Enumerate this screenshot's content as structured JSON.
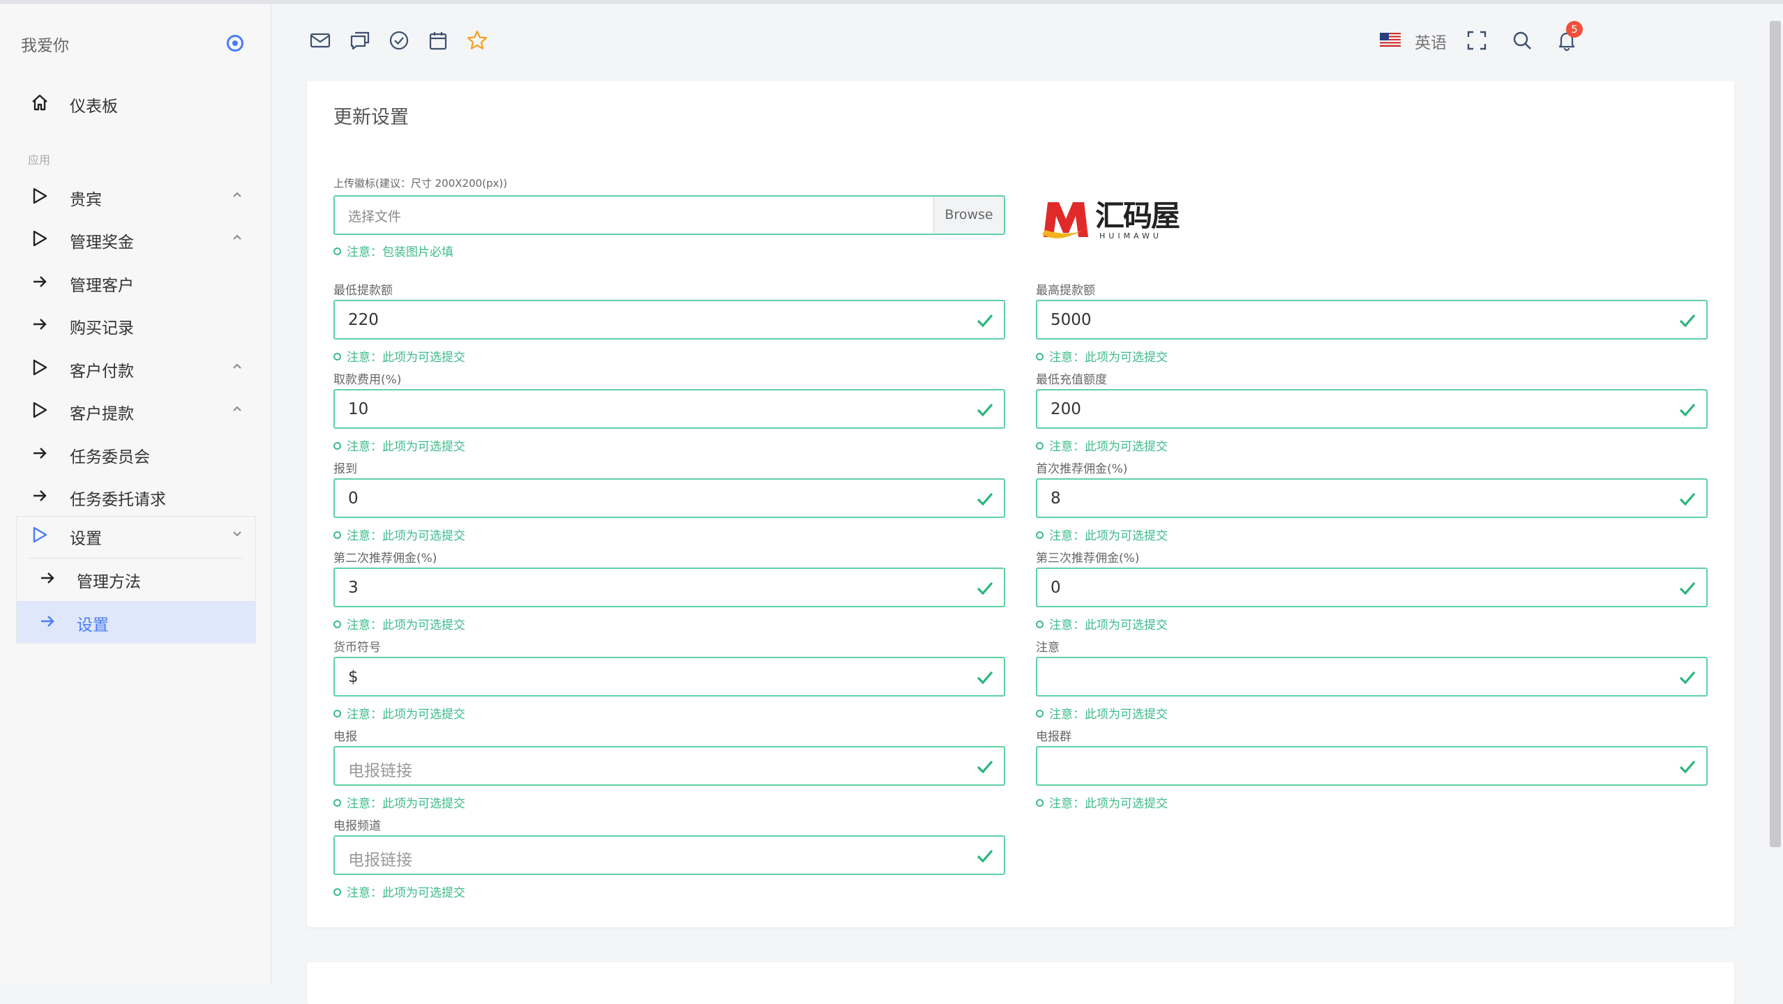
{
  "sidebar": {
    "brand": "我爱你",
    "items": [
      {
        "label": "仪表板"
      },
      {
        "label": "贵宾"
      },
      {
        "label": "管理奖金"
      },
      {
        "label": "管理客户"
      },
      {
        "label": "购买记录"
      },
      {
        "label": "客户付款"
      },
      {
        "label": "客户提款"
      },
      {
        "label": "任务委员会"
      },
      {
        "label": "任务委托请求"
      },
      {
        "label": "设置"
      },
      {
        "label": "管理方法"
      },
      {
        "label": "设置"
      }
    ],
    "section_label": "应用"
  },
  "header": {
    "language": "英语",
    "notification_count": "5"
  },
  "card": {
    "title": "更新设置",
    "upload": {
      "label": "上传徽标(建议：尺寸 200X200(px))",
      "placeholder": "选择文件",
      "browse": "Browse",
      "hint": "注意：包装图片必填"
    },
    "logo": {
      "text": "汇码屋",
      "subtext": "HUIMAWU"
    },
    "fields": [
      {
        "label": "最低提款额",
        "value": "220",
        "placeholder": "",
        "hint": "注意：此项为可选提交"
      },
      {
        "label": "最高提款额",
        "value": "5000",
        "placeholder": "",
        "hint": "注意：此项为可选提交"
      },
      {
        "label": "取款费用(%)",
        "value": "10",
        "placeholder": "",
        "hint": "注意：此项为可选提交"
      },
      {
        "label": "最低充值额度",
        "value": "200",
        "placeholder": "",
        "hint": "注意：此项为可选提交"
      },
      {
        "label": "报到",
        "value": "0",
        "placeholder": "",
        "hint": "注意：此项为可选提交"
      },
      {
        "label": "首次推荐佣金(%)",
        "value": "8",
        "placeholder": "",
        "hint": "注意：此项为可选提交"
      },
      {
        "label": "第二次推荐佣金(%)",
        "value": "3",
        "placeholder": "",
        "hint": "注意：此项为可选提交"
      },
      {
        "label": "第三次推荐佣金(%)",
        "value": "0",
        "placeholder": "",
        "hint": "注意：此项为可选提交"
      },
      {
        "label": "货币符号",
        "value": "$",
        "placeholder": "",
        "hint": "注意：此项为可选提交"
      },
      {
        "label": "注意",
        "value": "",
        "placeholder": "",
        "hint": "注意：此项为可选提交"
      },
      {
        "label": "电报",
        "value": "",
        "placeholder": "电报链接",
        "hint": "注意：此项为可选提交"
      },
      {
        "label": "电报群",
        "value": "",
        "placeholder": "",
        "hint": "注意：此项为可选提交"
      },
      {
        "label": "电报频道",
        "value": "",
        "placeholder": "电报链接",
        "hint": "注意：此项为可选提交"
      }
    ]
  },
  "colors": {
    "accent": "#4a7cf5",
    "valid_border": "#5fd1a3",
    "valid_text": "#3dbb8b",
    "badge": "#f0503c"
  }
}
